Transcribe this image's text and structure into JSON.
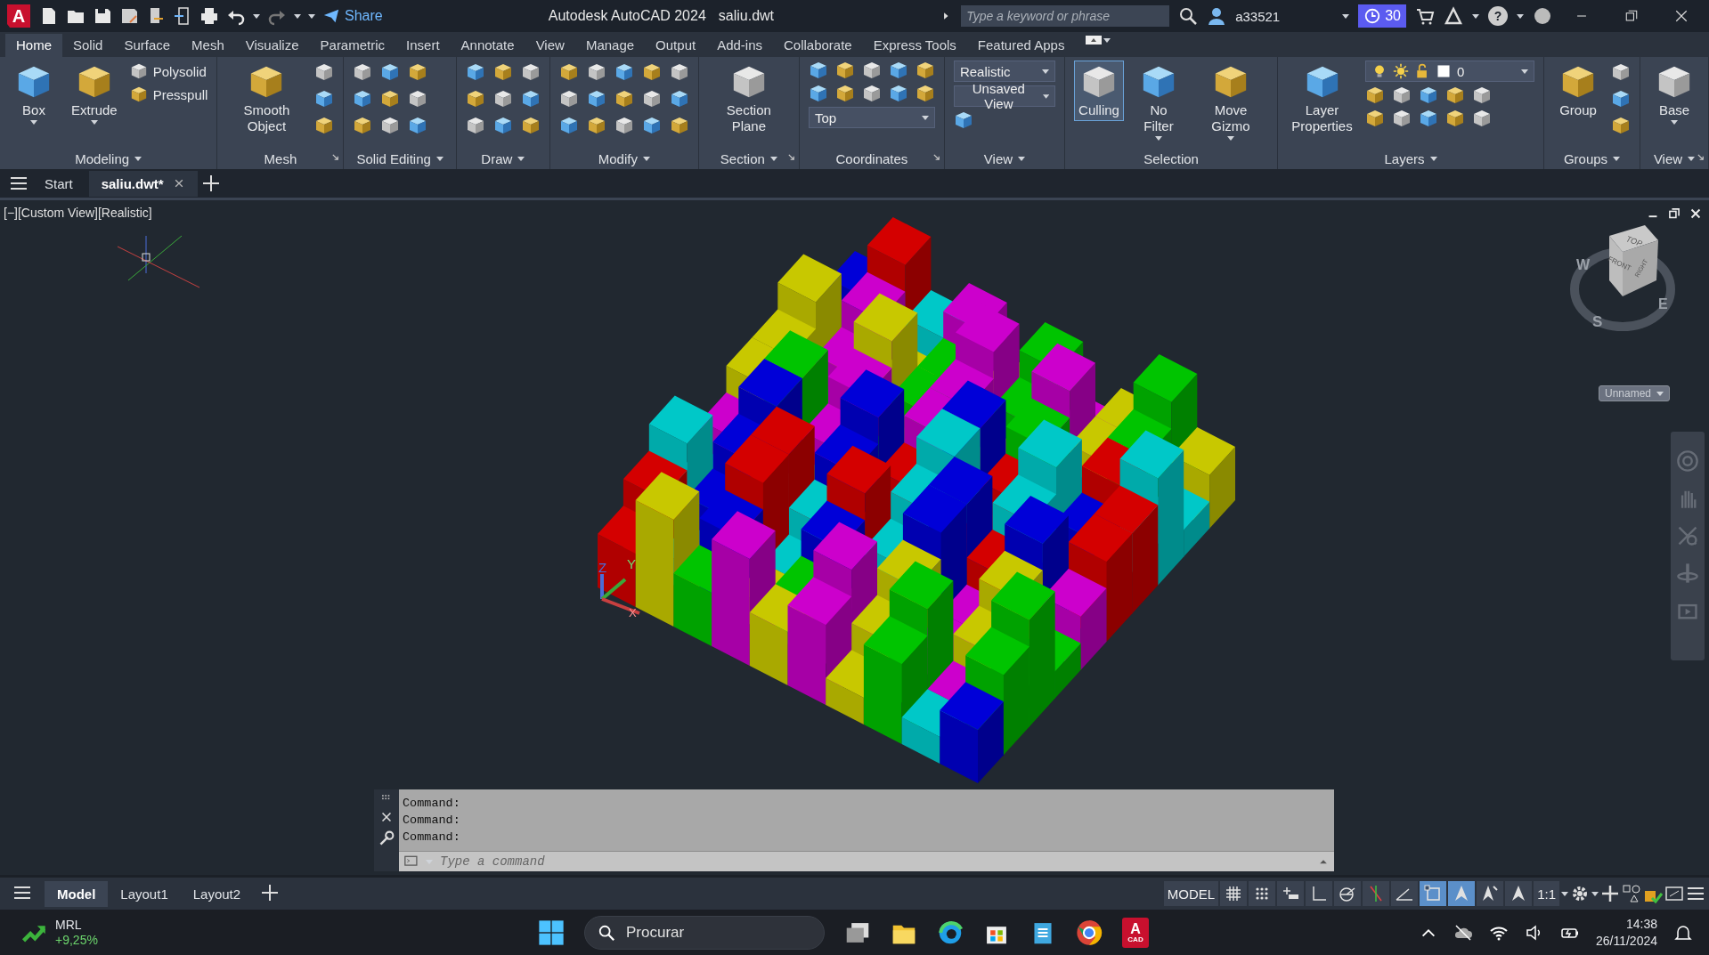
{
  "title_bar": {
    "app_logo": "A",
    "share": "Share",
    "title": "Autodesk AutoCAD 2024",
    "filename": "saliu.dwt",
    "search": {
      "placeholder": "Type a keyword or phrase"
    },
    "user": "a33521",
    "trial_days": "30",
    "help": "?"
  },
  "ribbon_tabs": [
    {
      "label": "Home",
      "selected": true
    },
    {
      "label": "Solid",
      "selected": false
    },
    {
      "label": "Surface",
      "selected": false
    },
    {
      "label": "Mesh",
      "selected": false
    },
    {
      "label": "Visualize",
      "selected": false
    },
    {
      "label": "Parametric",
      "selected": false
    },
    {
      "label": "Insert",
      "selected": false
    },
    {
      "label": "Annotate",
      "selected": false
    },
    {
      "label": "View",
      "selected": false
    },
    {
      "label": "Manage",
      "selected": false
    },
    {
      "label": "Output",
      "selected": false
    },
    {
      "label": "Add-ins",
      "selected": false
    },
    {
      "label": "Collaborate",
      "selected": false
    },
    {
      "label": "Express Tools",
      "selected": false
    },
    {
      "label": "Featured Apps",
      "selected": false
    }
  ],
  "ribbon_panels": [
    {
      "title": "Modeling",
      "menu": true,
      "launcher": false,
      "tools": [
        {
          "kind": "large",
          "label": "Box",
          "on": false,
          "has_menu": true
        },
        {
          "kind": "large",
          "label": "Extrude",
          "on": false,
          "has_menu": true
        },
        {
          "kind": "small_stack",
          "items": [
            "Polysolid",
            "Presspull"
          ]
        }
      ]
    },
    {
      "title": "Mesh",
      "menu": false,
      "launcher": true,
      "tools": [
        {
          "kind": "large",
          "label": "Smooth Object",
          "on": false,
          "has_menu": false
        },
        {
          "kind": "icon_column"
        }
      ]
    },
    {
      "title": "Solid Editing",
      "menu": true,
      "launcher": false,
      "tools": [
        {
          "kind": "icon_column"
        },
        {
          "kind": "icon_column"
        },
        {
          "kind": "icon_column"
        }
      ]
    },
    {
      "title": "Draw",
      "menu": true,
      "launcher": false,
      "tools": [
        {
          "kind": "icon_column"
        },
        {
          "kind": "icon_column"
        },
        {
          "kind": "icon_column"
        }
      ]
    },
    {
      "title": "Modify",
      "menu": true,
      "launcher": false,
      "tools": [
        {
          "kind": "icon_column"
        },
        {
          "kind": "icon_column"
        },
        {
          "kind": "icon_column"
        },
        {
          "kind": "icon_column"
        },
        {
          "kind": "icon_column"
        }
      ]
    },
    {
      "title": "Section",
      "menu": true,
      "launcher": true,
      "tools": [
        {
          "kind": "large",
          "label": "Section Plane",
          "on": false,
          "has_menu": false
        }
      ]
    },
    {
      "title": "Coordinates",
      "menu": false,
      "launcher": true,
      "tools": [
        {
          "kind": "stack",
          "children": [
            {
              "kind": "icon_row"
            },
            {
              "kind": "icon_row"
            },
            {
              "kind": "dropdown",
              "value": "Top"
            }
          ]
        }
      ]
    },
    {
      "title": "View",
      "menu": true,
      "launcher": false,
      "tools": [
        {
          "kind": "stack",
          "children": [
            {
              "kind": "dropdown",
              "value": "Realistic"
            },
            {
              "kind": "dropdown",
              "value": "Unsaved View"
            },
            {
              "kind": "icon"
            }
          ]
        }
      ]
    },
    {
      "title": "Selection",
      "menu": false,
      "launcher": false,
      "tools": [
        {
          "kind": "large",
          "label": "Culling",
          "on": true,
          "has_menu": false
        },
        {
          "kind": "large",
          "label": "No Filter",
          "on": false,
          "has_menu": true
        },
        {
          "kind": "large",
          "label": "Move Gizmo",
          "on": false,
          "has_menu": true
        }
      ]
    },
    {
      "title": "Layers",
      "menu": true,
      "launcher": false,
      "tools": [
        {
          "kind": "large",
          "label": "Layer Properties",
          "on": false,
          "has_menu": false
        },
        {
          "kind": "stack",
          "children": [
            {
              "kind": "layer_dropdown",
              "value": "0"
            },
            {
              "kind": "icon_row"
            },
            {
              "kind": "icon_row"
            }
          ]
        }
      ]
    },
    {
      "title": "Groups",
      "menu": true,
      "launcher": false,
      "tools": [
        {
          "kind": "large",
          "label": "Group",
          "on": false,
          "has_menu": false
        },
        {
          "kind": "icon_column"
        }
      ]
    },
    {
      "title": "View",
      "menu": true,
      "launcher": true,
      "tools": [
        {
          "kind": "large",
          "label": "Base",
          "on": false,
          "has_menu": true
        }
      ]
    }
  ],
  "document_tabs": [
    {
      "label": "Start",
      "selected": false,
      "closable": false
    },
    {
      "label": "saliu.dwt*",
      "selected": true,
      "closable": true
    }
  ],
  "viewport": {
    "label": [
      "[−]",
      "[Custom View]",
      "[Realistic]"
    ],
    "ucs_labels": [
      "Z",
      "Y",
      "X"
    ],
    "view_cube": {
      "top": "TOP",
      "front": "FRONT",
      "right": "RIGHT",
      "compass": [
        "W",
        "S",
        "E"
      ],
      "view_name": "Unnamed"
    }
  },
  "command_window": {
    "history": [
      "Command:",
      "Command:",
      "Command:"
    ],
    "placeholder": "Type a command"
  },
  "layout_tabs": [
    {
      "label": "Model",
      "selected": true
    },
    {
      "label": "Layout1",
      "selected": false
    },
    {
      "label": "Layout2",
      "selected": false
    }
  ],
  "status_bar": {
    "space": "MODEL",
    "scale": "1:1",
    "buttons": [
      {
        "on": false
      },
      {
        "on": false
      },
      {
        "on": false
      },
      {
        "on": false
      },
      {
        "on": false
      },
      {
        "on": false
      },
      {
        "on": false
      },
      {
        "on": true
      },
      {
        "on": true
      },
      {
        "on": false
      },
      {
        "on": false
      }
    ]
  },
  "taskbar": {
    "stock": {
      "symbol": "MRL",
      "change": "+9,25%"
    },
    "search": {
      "placeholder": "Procurar"
    },
    "autocad_icon": {
      "letter": "A",
      "caption": "CAD"
    },
    "time": "14:38",
    "date": "26/11/2024"
  }
}
